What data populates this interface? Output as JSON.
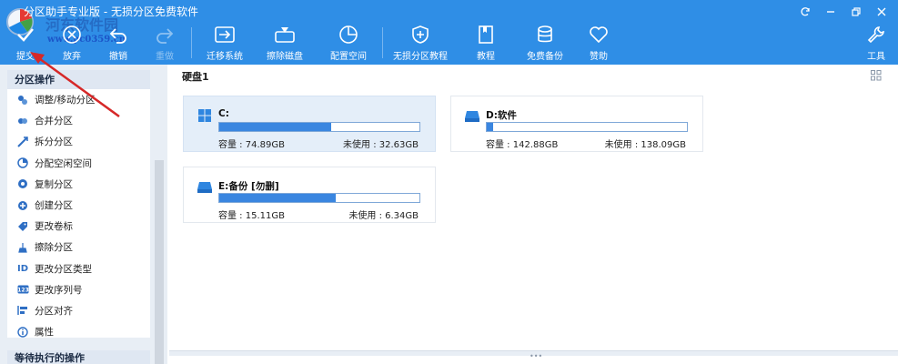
{
  "window": {
    "title": "分区助手专业版 - 无损分区免费软件",
    "watermark": "河东软件园",
    "watermark_url": "www.pc0359.cn"
  },
  "toolbar": {
    "items": [
      {
        "label": "提交",
        "icon": "check-icon"
      },
      {
        "label": "放弃",
        "icon": "discard-icon"
      },
      {
        "label": "撤销",
        "icon": "undo-icon"
      },
      {
        "label": "重做",
        "icon": "redo-icon",
        "disabled": true
      },
      {
        "label": "迁移系统",
        "icon": "migrate-system-icon"
      },
      {
        "label": "擦除磁盘",
        "icon": "wipe-disk-icon"
      },
      {
        "label": "配置空间",
        "icon": "allocate-space-icon"
      },
      {
        "label": "无损分区教程",
        "icon": "shield-plus-icon"
      },
      {
        "label": "教程",
        "icon": "book-icon"
      },
      {
        "label": "免费备份",
        "icon": "backup-icon"
      },
      {
        "label": "赞助",
        "icon": "heart-icon"
      },
      {
        "label": "工具",
        "icon": "wrench-icon"
      }
    ]
  },
  "sidebar": {
    "header": "分区操作",
    "items": [
      {
        "label": "调整/移动分区",
        "icon": "resize-icon"
      },
      {
        "label": "合并分区",
        "icon": "merge-icon"
      },
      {
        "label": "拆分分区",
        "icon": "split-icon"
      },
      {
        "label": "分配空闲空间",
        "icon": "pie-icon"
      },
      {
        "label": "复制分区",
        "icon": "copy-icon"
      },
      {
        "label": "创建分区",
        "icon": "create-icon"
      },
      {
        "label": "更改卷标",
        "icon": "tag-icon"
      },
      {
        "label": "擦除分区",
        "icon": "wipe-icon"
      },
      {
        "label": "更改分区类型",
        "icon": "id-icon"
      },
      {
        "label": "更改序列号",
        "icon": "serial-icon"
      },
      {
        "label": "分区对齐",
        "icon": "align-icon"
      },
      {
        "label": "属性",
        "icon": "info-icon"
      }
    ],
    "pending_header": "等待执行的操作"
  },
  "main": {
    "disk_title": "硬盘1",
    "partitions": [
      {
        "name": "C:",
        "capacity": "容量 : 74.89GB",
        "free": "未使用 : 32.63GB",
        "used_fraction": 0.56,
        "icon": "windows-icon",
        "selected": true
      },
      {
        "name": "D:软件",
        "capacity": "容量 : 142.88GB",
        "free": "未使用 : 138.09GB",
        "used_fraction": 0.03,
        "icon": "drive-icon",
        "selected": false
      },
      {
        "name": "E:备份 [勿删]",
        "capacity": "容量 : 15.11GB",
        "free": "未使用 : 6.34GB",
        "used_fraction": 0.58,
        "icon": "drive-icon",
        "selected": false
      }
    ]
  },
  "colors": {
    "toolbar_bg": "#2f8ee6",
    "bar_fill": "#3a86e0",
    "arrow": "#d62828"
  }
}
